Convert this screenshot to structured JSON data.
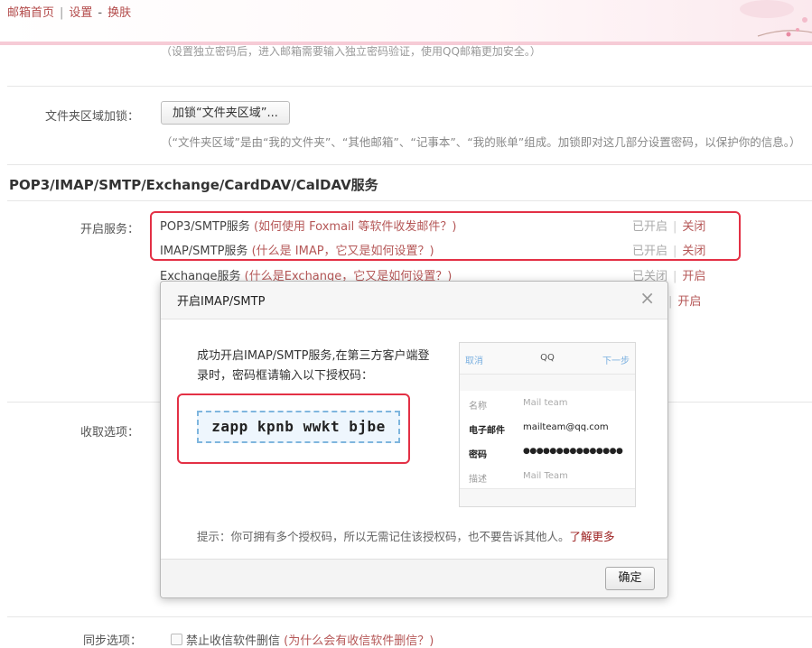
{
  "topbar": {
    "home": "邮箱首页",
    "sep": "|",
    "settings": "设置",
    "dash": "-",
    "skin": "换肤"
  },
  "prev_hint": "（设置独立密码后，进入邮箱需要输入独立密码验证，使用QQ邮箱更加安全。）",
  "folder_lock": {
    "label": "文件夹区域加锁：",
    "button": "加锁“文件夹区域”...",
    "hint": "（“文件夹区域”是由“我的文件夹”、“其他邮箱”、“记事本”、“我的账单”组成。加锁即对这几部分设置密码，以保护你的信息。）"
  },
  "section_title": "POP3/IMAP/SMTP/Exchange/CardDAV/CalDAV服务",
  "services": {
    "label": "开启服务：",
    "rows": [
      {
        "name": "POP3/SMTP服务",
        "question": "(如何使用 Foxmail 等软件收发邮件？)",
        "state": "已开启",
        "sep": "|",
        "action": "关闭"
      },
      {
        "name": "IMAP/SMTP服务",
        "question": "(什么是 IMAP，它又是如何设置？)",
        "state": "已开启",
        "sep": "|",
        "action": "关闭"
      },
      {
        "name": "Exchange服务",
        "question": "(什么是Exchange，它又是如何设置？)",
        "state": "已关闭",
        "sep": "|",
        "action": "开启"
      },
      {
        "name": "",
        "question": "",
        "state": "",
        "sep": "|",
        "action": "开启"
      }
    ]
  },
  "receive_label": "收取选项：",
  "sync": {
    "label": "同步选项：",
    "text": "禁止收信软件删信",
    "question": "(为什么会有收信软件删信？)"
  },
  "dialog": {
    "title": "开启IMAP/SMTP",
    "close": "×",
    "message": "成功开启IMAP/SMTP服务,在第三方客户端登录时，密码框请输入以下授权码：",
    "code": "zapp kpnb wwkt bjbe",
    "phone": {
      "cancel": "取消",
      "title": "QQ",
      "next": "下一步",
      "rows": [
        {
          "key": "名称",
          "value": "Mail team"
        },
        {
          "key": "电子邮件",
          "value": "mailteam@qq.com"
        },
        {
          "key": "密码",
          "value": "●●●●●●●●●●●●●●●"
        },
        {
          "key": "描述",
          "value": "Mail Team"
        }
      ]
    },
    "tip": "提示：你可拥有多个授权码，所以无需记住该授权码，也不要告诉其他人。",
    "learn_more": "了解更多",
    "ok": "确定"
  },
  "colors": {
    "highlight_red": "#e33045",
    "link_red": "#b55757",
    "topbar_pink": "#f6cbd6"
  }
}
